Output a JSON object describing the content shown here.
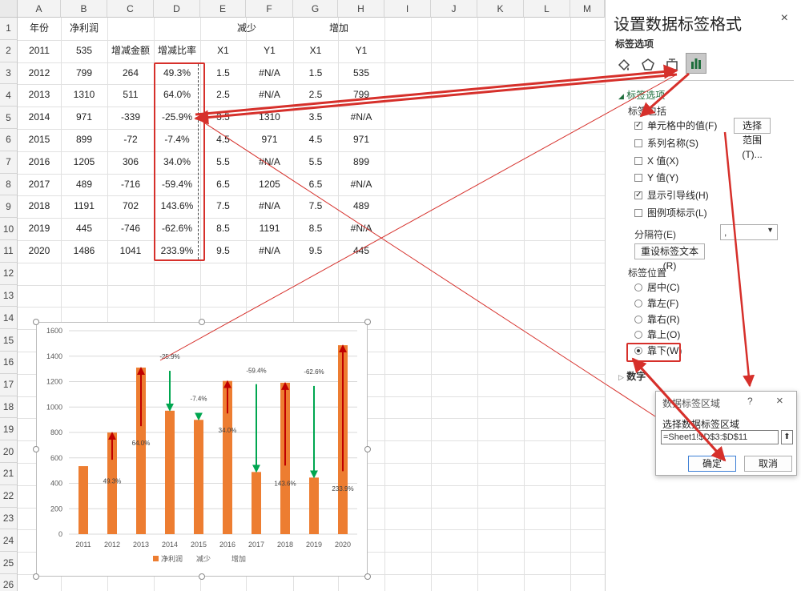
{
  "columns": [
    "A",
    "B",
    "C",
    "D",
    "E",
    "F",
    "G",
    "H",
    "I",
    "J",
    "K",
    "L",
    "M"
  ],
  "rows": [
    "1",
    "2",
    "3",
    "4",
    "5",
    "6",
    "7",
    "8",
    "9",
    "10",
    "11",
    "12",
    "13",
    "14",
    "15",
    "16",
    "17",
    "18",
    "19",
    "20",
    "21",
    "22",
    "23",
    "24",
    "25",
    "26"
  ],
  "table": {
    "header1": {
      "a": "年份",
      "b": "净利润",
      "ef": "减少",
      "gh": "增加"
    },
    "header2": {
      "a": "2011",
      "b": "535",
      "c": "增减金额",
      "d": "增减比率",
      "e": "X1",
      "f": "Y1",
      "g": "X1",
      "h": "Y1"
    },
    "data": [
      {
        "a": "2012",
        "b": "799",
        "c": "264",
        "d": "49.3%",
        "e": "1.5",
        "f": "#N/A",
        "g": "1.5",
        "h": "535"
      },
      {
        "a": "2013",
        "b": "1310",
        "c": "511",
        "d": "64.0%",
        "e": "2.5",
        "f": "#N/A",
        "g": "2.5",
        "h": "799"
      },
      {
        "a": "2014",
        "b": "971",
        "c": "-339",
        "d": "-25.9%",
        "e": "3.5",
        "f": "1310",
        "g": "3.5",
        "h": "#N/A"
      },
      {
        "a": "2015",
        "b": "899",
        "c": "-72",
        "d": "-7.4%",
        "e": "4.5",
        "f": "971",
        "g": "4.5",
        "h": "971"
      },
      {
        "a": "2016",
        "b": "1205",
        "c": "306",
        "d": "34.0%",
        "e": "5.5",
        "f": "#N/A",
        "g": "5.5",
        "h": "899"
      },
      {
        "a": "2017",
        "b": "489",
        "c": "-716",
        "d": "-59.4%",
        "e": "6.5",
        "f": "1205",
        "g": "6.5",
        "h": "#N/A"
      },
      {
        "a": "2018",
        "b": "1191",
        "c": "702",
        "d": "143.6%",
        "e": "7.5",
        "f": "#N/A",
        "g": "7.5",
        "h": "489"
      },
      {
        "a": "2019",
        "b": "445",
        "c": "-746",
        "d": "-62.6%",
        "e": "8.5",
        "f": "1191",
        "g": "8.5",
        "h": "#N/A"
      },
      {
        "a": "2020",
        "b": "1486",
        "c": "1041",
        "d": "233.9%",
        "e": "9.5",
        "f": "#N/A",
        "g": "9.5",
        "h": "445"
      }
    ]
  },
  "chart_data": {
    "type": "bar",
    "categories": [
      "2011",
      "2012",
      "2013",
      "2014",
      "2015",
      "2016",
      "2017",
      "2018",
      "2019",
      "2020"
    ],
    "series": [
      {
        "name": "净利润",
        "values": [
          535,
          799,
          1310,
          971,
          899,
          1205,
          489,
          1191,
          445,
          1486
        ]
      }
    ],
    "ylim": [
      0,
      1600
    ],
    "yticks": [
      "0",
      "200",
      "400",
      "600",
      "800",
      "1000",
      "1200",
      "1400",
      "1600"
    ],
    "arrows": [
      {
        "x": 1.5,
        "from": 535,
        "to": 799,
        "dir": "up"
      },
      {
        "x": 2.5,
        "from": 799,
        "to": 1310,
        "dir": "up"
      },
      {
        "x": 3.5,
        "from": 1310,
        "to": 971,
        "dir": "down"
      },
      {
        "x": 4.5,
        "from": 971,
        "to": 899,
        "dir": "down"
      },
      {
        "x": 5.5,
        "from": 899,
        "to": 1205,
        "dir": "up"
      },
      {
        "x": 6.5,
        "from": 1205,
        "to": 489,
        "dir": "down"
      },
      {
        "x": 7.5,
        "from": 489,
        "to": 1191,
        "dir": "up"
      },
      {
        "x": 8.5,
        "from": 1191,
        "to": 445,
        "dir": "down"
      },
      {
        "x": 9.5,
        "from": 445,
        "to": 1486,
        "dir": "up"
      }
    ],
    "labels": [
      {
        "x": 1.5,
        "y": 400,
        "text": "49.3%"
      },
      {
        "x": 2.5,
        "y": 700,
        "text": "64.0%"
      },
      {
        "x": 3.5,
        "y": 1380,
        "text": "-25.9%"
      },
      {
        "x": 4.5,
        "y": 1050,
        "text": "-7.4%"
      },
      {
        "x": 5.5,
        "y": 800,
        "text": "34.0%"
      },
      {
        "x": 6.5,
        "y": 1270,
        "text": "-59.4%"
      },
      {
        "x": 7.5,
        "y": 380,
        "text": "143.6%"
      },
      {
        "x": 8.5,
        "y": 1260,
        "text": "-62.6%"
      },
      {
        "x": 9.5,
        "y": 340,
        "text": "233.9%"
      }
    ],
    "legend": [
      "净利润",
      "减少",
      "增加"
    ],
    "legend_position": "bottom",
    "grid": true,
    "colors": {
      "bar": "#ed7d31",
      "up": "#c00000",
      "down": "#00a650"
    }
  },
  "pane": {
    "title": "设置数据标签格式",
    "close": "×",
    "section": "标签选项",
    "sub_section": "标签选项",
    "contains": "标签包括",
    "options": [
      {
        "label": "单元格中的值(F)",
        "checked": true
      },
      {
        "label": "系列名称(S)",
        "checked": false
      },
      {
        "label": "X 值(X)",
        "checked": false
      },
      {
        "label": "Y 值(Y)",
        "checked": false
      },
      {
        "label": "显示引导线(H)",
        "checked": true
      },
      {
        "label": "图例项标示(L)",
        "checked": false
      }
    ],
    "select_range_btn": "选择范围(T)...",
    "separator_label": "分隔符(E)",
    "separator_value": ",",
    "reset_btn": "重设标签文本(R)",
    "position_label": "标签位置",
    "positions": [
      {
        "label": "居中(C)",
        "on": false
      },
      {
        "label": "靠左(F)",
        "on": false
      },
      {
        "label": "靠右(R)",
        "on": false
      },
      {
        "label": "靠上(O)",
        "on": false
      },
      {
        "label": "靠下(W)",
        "on": true
      }
    ],
    "number": "数字",
    "tab_icons": [
      "fill-line-icon",
      "effects-icon",
      "size-properties-icon",
      "label-options-icon"
    ]
  },
  "dialog": {
    "title": "数据标签区域",
    "help": "?",
    "close": "×",
    "prompt": "选择数据标签区域",
    "value": "=Sheet1!$D$3:$D$11",
    "ok": "确定",
    "cancel": "取消"
  },
  "accent": "#d6302b"
}
